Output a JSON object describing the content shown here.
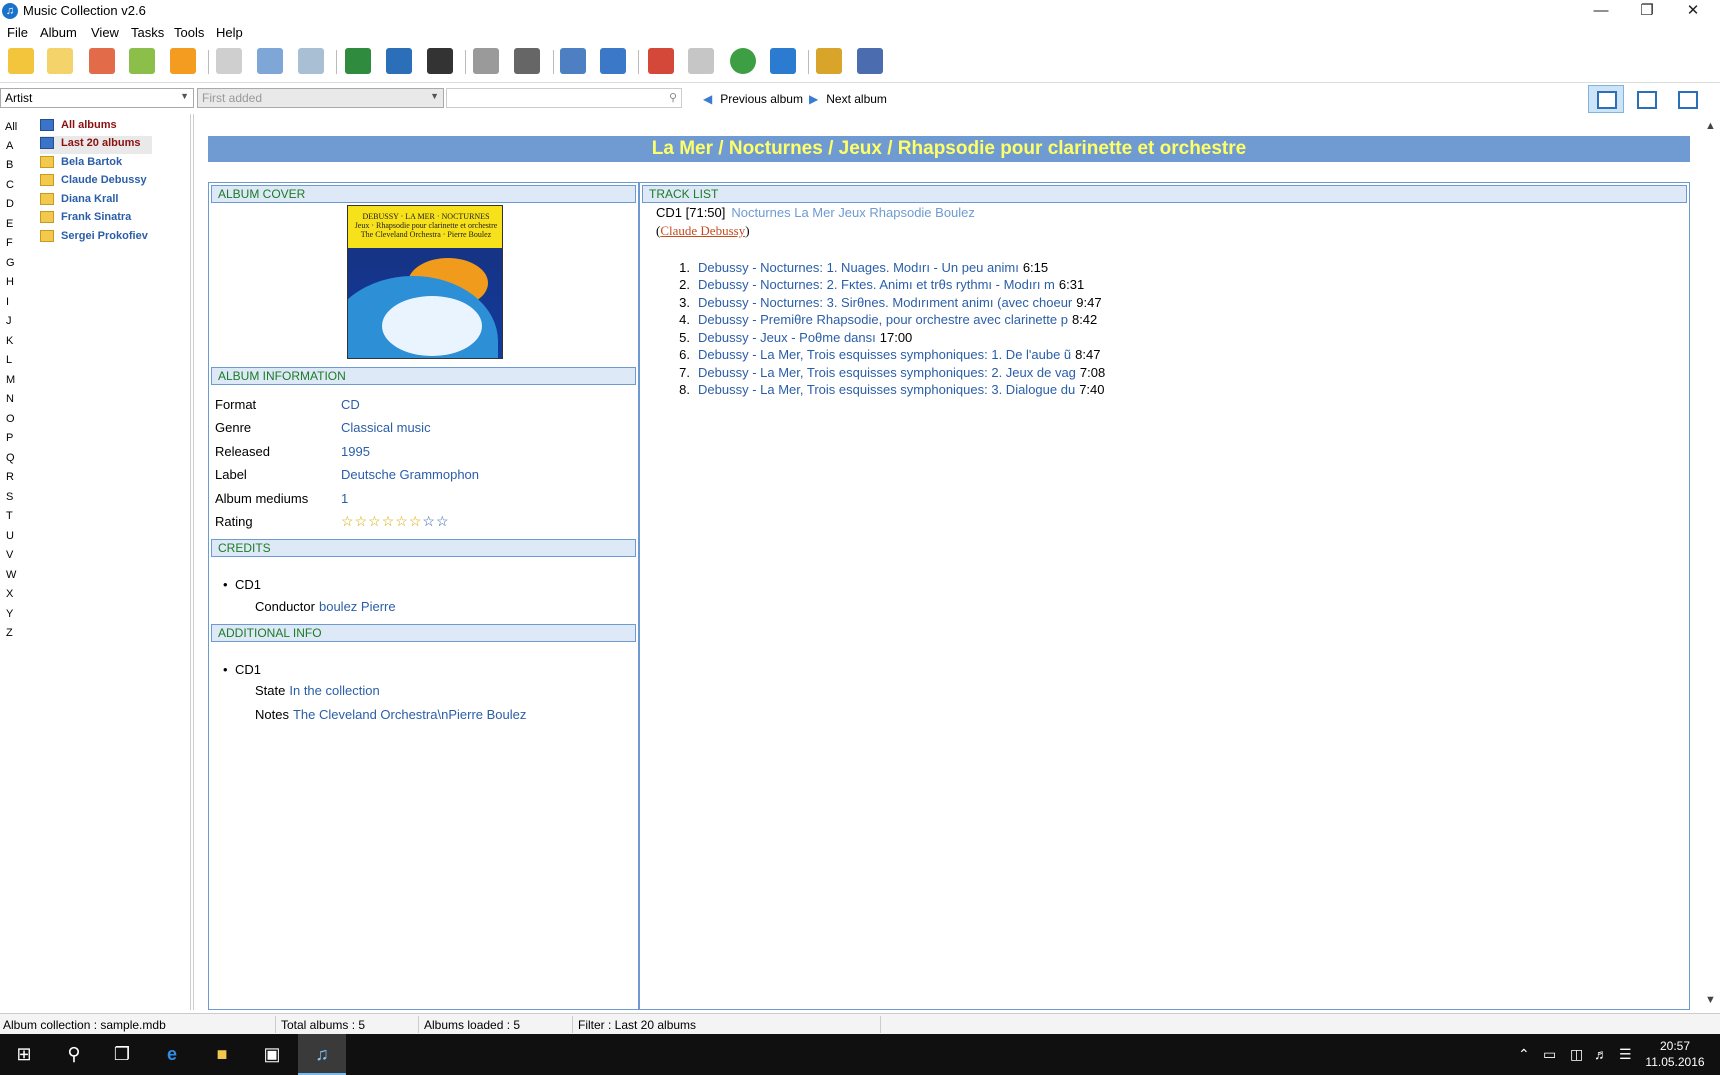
{
  "window": {
    "title": "Music Collection v2.6",
    "minimize": "—",
    "restore": "❐",
    "close": "✕"
  },
  "menu": [
    "File",
    "Album",
    "View",
    "Tasks",
    "Tools",
    "Help"
  ],
  "filters": {
    "field": "Artist",
    "sort": "First added",
    "search_value": "",
    "previous": "Previous album",
    "next": "Next album"
  },
  "letters": [
    "All",
    "A",
    "B",
    "C",
    "D",
    "E",
    "F",
    "G",
    "H",
    "I",
    "J",
    "K",
    "L",
    "M",
    "N",
    "O",
    "P",
    "Q",
    "R",
    "S",
    "T",
    "U",
    "V",
    "W",
    "X",
    "Y",
    "Z"
  ],
  "tree": [
    {
      "label": "All albums",
      "type": "root"
    },
    {
      "label": "Last 20 albums",
      "type": "root",
      "selected": true
    },
    {
      "label": "Bela Bartok",
      "type": "folder"
    },
    {
      "label": "Claude Debussy",
      "type": "folder"
    },
    {
      "label": "Diana Krall",
      "type": "folder"
    },
    {
      "label": "Frank Sinatra",
      "type": "folder"
    },
    {
      "label": "Sergei Prokofiev",
      "type": "folder"
    }
  ],
  "album": {
    "title": "La Mer / Nocturnes / Jeux / Rhapsodie pour clarinette et orchestre",
    "cover_text": "DEBUSSY · LA MER · NOCTURNES\nJeux · Rhapsodie pour clarinette et orchestre\nThe Cleveland Orchestra · Pierre Boulez"
  },
  "sections": {
    "cover": "ALBUM COVER",
    "info": "ALBUM INFORMATION",
    "credits": "CREDITS",
    "additional": "ADDITIONAL INFO",
    "tracklist": "TRACK LIST"
  },
  "info": {
    "format_label": "Format",
    "format": "CD",
    "genre_label": "Genre",
    "genre": "Classical music",
    "released_label": "Released",
    "released": "1995",
    "label_label": "Label",
    "label": "Deutsche Grammophon",
    "mediums_label": "Album mediums",
    "mediums": "1",
    "rating_label": "Rating",
    "rating": 6,
    "rating_max": 8
  },
  "credits": {
    "disc": "CD1",
    "role": "Conductor",
    "person": "boulez Pierre"
  },
  "additional": {
    "disc": "CD1",
    "state_label": "State",
    "state": "In the collection",
    "notes_label": "Notes",
    "notes": "The Cleveland Orchestra\\nPierre Boulez"
  },
  "tracklist": {
    "disc": "CD1 [71:50]",
    "disc_title": "Nocturnes La Mer Jeux Rhapsodie Boulez",
    "artist_open": "(",
    "artist": "Claude Debussy",
    "artist_close": ")",
    "tracks": [
      {
        "n": "1.",
        "name": "Debussy - Nocturnes: 1. Nuages. Modırı - Un peu animı",
        "dur": "6:15"
      },
      {
        "n": "2.",
        "name": "Debussy - Nocturnes: 2. Fĸtes. Animı et trθs rythmı - Modırı m",
        "dur": "6:31"
      },
      {
        "n": "3.",
        "name": "Debussy - Nocturnes: 3. Sirθnes. Modırıment animı (avec choeur",
        "dur": "9:47"
      },
      {
        "n": "4.",
        "name": "Debussy - Premiθre Rhapsodie, pour orchestre avec clarinette p",
        "dur": "8:42"
      },
      {
        "n": "5.",
        "name": "Debussy - Jeux - Poθme dansı",
        "dur": "17:00"
      },
      {
        "n": "6.",
        "name": "Debussy - La Mer, Trois esquisses symphoniques: 1. De l'aube ũ",
        "dur": "8:47"
      },
      {
        "n": "7.",
        "name": "Debussy - La Mer, Trois esquisses symphoniques: 2. Jeux de vag",
        "dur": "7:08"
      },
      {
        "n": "8.",
        "name": "Debussy - La Mer, Trois esquisses symphoniques: 3. Dialogue du",
        "dur": "7:40"
      }
    ]
  },
  "status": {
    "collection": "Album collection : sample.mdb",
    "total": "Total albums : 5",
    "loaded": "Albums loaded : 5",
    "filter": "Filter : Last 20 albums"
  },
  "clock": {
    "time": "20:57",
    "date": "11.05.2016"
  },
  "colors": {
    "title_bar_blue": "#6f9bd2",
    "title_text": "#ffff66",
    "section_green": "#1d7a26",
    "link_blue": "#2b5ea8"
  }
}
